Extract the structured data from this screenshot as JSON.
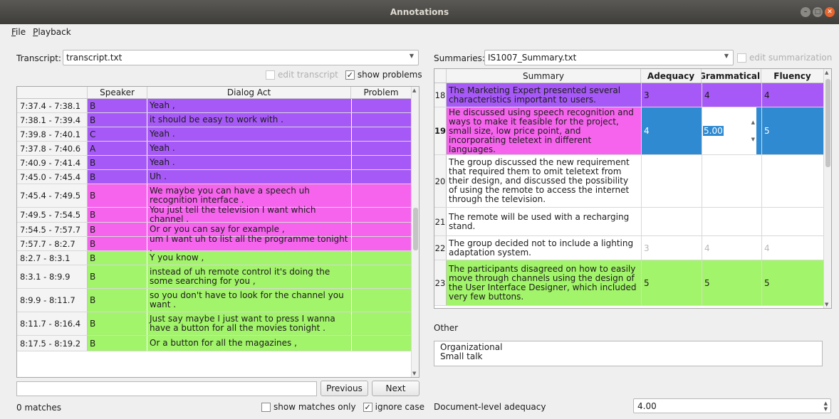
{
  "window": {
    "title": "Annotations"
  },
  "menu": {
    "file": {
      "mnemonic": "F",
      "rest": "ile"
    },
    "playback": {
      "mnemonic": "P",
      "rest": "layback"
    }
  },
  "transcript": {
    "label": "Transcript:",
    "file": "transcript.txt",
    "edit_transcript": {
      "label": "edit transcript",
      "checked": false,
      "enabled": false
    },
    "show_problems": {
      "label": "show problems",
      "checked": true
    },
    "columns": [
      "Speaker",
      "Dialog Act",
      "Problem"
    ],
    "rows": [
      {
        "time": "7:37.4 - 7:38.1",
        "speaker": "B",
        "act": "Yeah ,",
        "problem": "",
        "color": "#a659f7"
      },
      {
        "time": "7:38.1 - 7:39.4",
        "speaker": "B",
        "act": "it should be easy to work with .",
        "problem": "",
        "color": "#a659f7"
      },
      {
        "time": "7:39.8 - 7:40.1",
        "speaker": "C",
        "act": "Yeah .",
        "problem": "",
        "color": "#a659f7"
      },
      {
        "time": "7:37.8 - 7:40.6",
        "speaker": "A",
        "act": "Yeah .",
        "problem": "",
        "color": "#a659f7"
      },
      {
        "time": "7:40.9 - 7:41.4",
        "speaker": "B",
        "act": "Yeah .",
        "problem": "",
        "color": "#a659f7"
      },
      {
        "time": "7:45.0 - 7:45.4",
        "speaker": "B",
        "act": "Uh .",
        "problem": "",
        "color": "#a659f7"
      },
      {
        "time": "7:45.4 - 7:49.5",
        "speaker": "B",
        "act": "We maybe you can have a speech uh recognition interface .",
        "problem": "",
        "color": "#f664ee"
      },
      {
        "time": "7:49.5 - 7:54.5",
        "speaker": "B",
        "act": "You just tell the television I want which channel .",
        "problem": "",
        "color": "#f664ee"
      },
      {
        "time": "7:54.5 - 7:57.7",
        "speaker": "B",
        "act": "Or or you can say for example ,",
        "problem": "",
        "color": "#f664ee"
      },
      {
        "time": "7:57.7 - 8:2.7",
        "speaker": "B",
        "act": "um I want uh to list all the programme tonight .",
        "problem": "",
        "color": "#f664ee"
      },
      {
        "time": "8:2.7 - 8:3.1",
        "speaker": "B",
        "act": "Y you know ,",
        "problem": "",
        "color": "#a2f46a"
      },
      {
        "time": "8:3.1 - 8:9.9",
        "speaker": "B",
        "act": "instead of uh remote control it's doing the some searching for you ,",
        "problem": "",
        "color": "#a2f46a"
      },
      {
        "time": "8:9.9 - 8:11.7",
        "speaker": "B",
        "act": "so you don't have to look for the channel you want .",
        "problem": "",
        "color": "#a2f46a"
      },
      {
        "time": "8:11.7 - 8:16.4",
        "speaker": "B",
        "act": "Just say maybe I just want to press I wanna have a button for all the movies tonight .",
        "problem": "",
        "color": "#a2f46a"
      },
      {
        "time": "8:17.5 - 8:19.2",
        "speaker": "B",
        "act": "Or a button for all the magazines ,",
        "problem": "",
        "color": "#a2f46a"
      }
    ]
  },
  "search": {
    "value": "",
    "previous": "Previous",
    "next": "Next",
    "matches": "0 matches",
    "show_matches_only": {
      "label": "show matches only",
      "checked": false
    },
    "ignore_case": {
      "label": "ignore case",
      "checked": true
    }
  },
  "summaries": {
    "label": "Summaries:",
    "file": "IS1007_Summary.txt",
    "edit_summarization": {
      "label": "edit summarization",
      "checked": false,
      "enabled": false
    },
    "columns": [
      "Summary",
      "Adequacy",
      "Grammaticality",
      "Fluency"
    ],
    "rows": [
      {
        "num": "18",
        "text": "The Marketing Expert presented several characteristics important to users.",
        "adequacy": "3",
        "grammaticality": "4",
        "fluency": "4",
        "color": "#a659f7"
      },
      {
        "num": "19",
        "text": "He discussed using speech recognition and ways to make it feasible for the project, small size, low price point, and incorporating teletext in different languages.",
        "adequacy": "4",
        "grammaticality": "5.00",
        "fluency": "5",
        "color": "#f664ee"
      },
      {
        "num": "20",
        "text": "The group discussed the new requirement that required them to omit teletext from their design, and discussed the possibility of using the remote to access the internet through the television.",
        "adequacy": "",
        "grammaticality": "",
        "fluency": "",
        "color": "#ffffff"
      },
      {
        "num": "21",
        "text": "The remote will be used with a recharging stand.",
        "adequacy": "",
        "grammaticality": "",
        "fluency": "",
        "color": "#ffffff"
      },
      {
        "num": "22",
        "text": "The group decided not to include a lighting adaptation system.",
        "adequacy": "3",
        "grammaticality": "4",
        "fluency": "4",
        "color": "#ffffff"
      },
      {
        "num": "23",
        "text": "The participants disagreed on how to easily move through channels using the design of the User Interface Designer, which included very few buttons.",
        "adequacy": "5",
        "grammaticality": "5",
        "fluency": "5",
        "color": "#a2f46a"
      }
    ]
  },
  "other": {
    "label": "Other",
    "lines": [
      "Organizational",
      "Small talk"
    ]
  },
  "document_adequacy": {
    "label": "Document-level adequacy",
    "value": "4.00"
  }
}
